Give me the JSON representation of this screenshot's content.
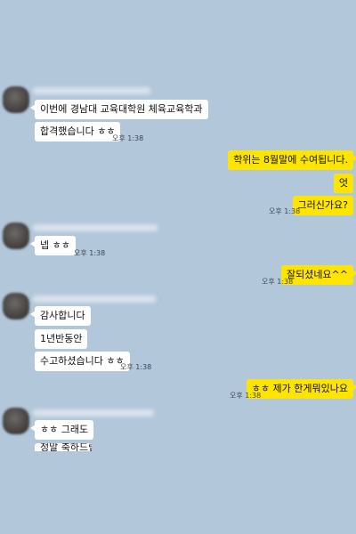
{
  "time_label": "오후 1:38",
  "groups": [
    {
      "messages": [
        "이번에 경남대 교육대학원 체육교육학과",
        "합격했습니다 ㅎㅎ"
      ]
    },
    {
      "messages": [
        "학위는 8월말에 수여됩니다.",
        "엇",
        "그러신가요?"
      ]
    },
    {
      "messages": [
        "넵 ㅎㅎ"
      ]
    },
    {
      "messages": [
        "잘되셨네요^^"
      ]
    },
    {
      "messages": [
        "감사합니다",
        "1년반동안",
        "수고하셨습니다 ㅎㅎ"
      ]
    },
    {
      "messages": [
        "ㅎㅎ 제가 한게뭐있나요"
      ]
    },
    {
      "messages": [
        "ㅎㅎ 그래도",
        "정말 축하드립니다"
      ]
    }
  ]
}
